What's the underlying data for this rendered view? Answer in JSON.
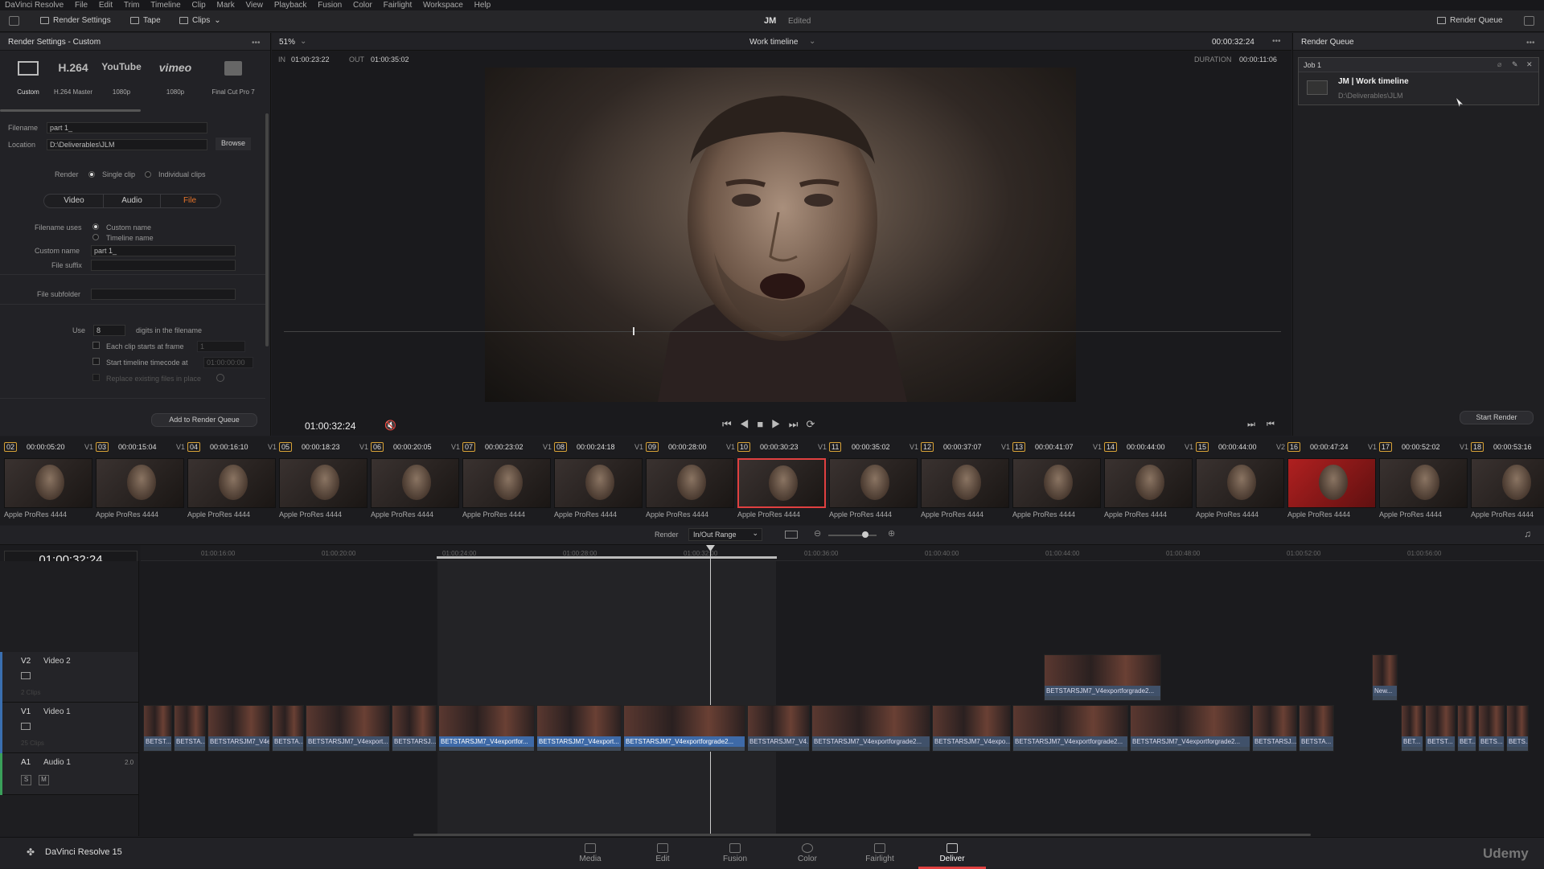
{
  "menu": {
    "app": "DaVinci Resolve",
    "items": [
      "File",
      "Edit",
      "Trim",
      "Timeline",
      "Clip",
      "Mark",
      "View",
      "Playback",
      "Fusion",
      "Color",
      "Fairlight",
      "Workspace",
      "Help"
    ]
  },
  "topbar": {
    "render_settings": "Render Settings",
    "tape": "Tape",
    "clips": "Clips",
    "project": "JM",
    "status": "Edited",
    "render_queue": "Render Queue"
  },
  "left": {
    "title": "Render Settings - Custom",
    "presets": [
      {
        "big": "",
        "label": "Custom"
      },
      {
        "big": "H.264",
        "label": "H.264 Master"
      },
      {
        "big": "YouTube",
        "label": "1080p"
      },
      {
        "big": "vimeo",
        "label": "1080p"
      },
      {
        "big": "",
        "label": "Final Cut Pro 7"
      }
    ],
    "filename_label": "Filename",
    "filename": "part 1_",
    "location_label": "Location",
    "location": "D:\\Deliverables\\JLM",
    "browse": "Browse",
    "render_label": "Render",
    "single_clip": "Single clip",
    "individual_clips": "Individual clips",
    "tabs": [
      "Video",
      "Audio",
      "File"
    ],
    "filename_uses": "Filename uses",
    "custom_name_opt": "Custom name",
    "timeline_name_opt": "Timeline name",
    "custom_name_label": "Custom name",
    "custom_name": "part 1_",
    "file_suffix": "File suffix",
    "file_subfolder": "File subfolder",
    "use": "Use",
    "digits": "8",
    "digits_text": "digits in the filename",
    "each_clip": "Each clip starts at frame",
    "each_clip_val": "1",
    "start_tc": "Start timeline timecode at",
    "start_tc_val": "01:00:00:00",
    "replace": "Replace existing files in place",
    "add_queue": "Add to Render Queue"
  },
  "viewer": {
    "zoom": "51%",
    "timeline": "Work timeline",
    "tc_top": "00:00:32:24",
    "in_label": "IN",
    "in_tc": "01:00:23:22",
    "out_label": "OUT",
    "out_tc": "01:00:35:02",
    "duration_label": "DURATION",
    "duration": "00:00:11:06",
    "current_tc": "01:00:32:24"
  },
  "queue": {
    "title": "Render Queue",
    "job": "Job 1",
    "job_name": "JM | Work timeline",
    "job_path": "D:\\Deliverables\\JLM",
    "start": "Start Render"
  },
  "clips": [
    {
      "n": "02",
      "tc": "00:00:05:20",
      "tr": "V1",
      "codec": "Apple ProRes 4444"
    },
    {
      "n": "03",
      "tc": "00:00:15:04",
      "tr": "V1",
      "codec": "Apple ProRes 4444"
    },
    {
      "n": "04",
      "tc": "00:00:16:10",
      "tr": "V1",
      "codec": "Apple ProRes 4444"
    },
    {
      "n": "05",
      "tc": "00:00:18:23",
      "tr": "V1",
      "codec": "Apple ProRes 4444"
    },
    {
      "n": "06",
      "tc": "00:00:20:05",
      "tr": "V1",
      "codec": "Apple ProRes 4444"
    },
    {
      "n": "07",
      "tc": "00:00:23:02",
      "tr": "V1",
      "codec": "Apple ProRes 4444"
    },
    {
      "n": "08",
      "tc": "00:00:24:18",
      "tr": "V1",
      "codec": "Apple ProRes 4444"
    },
    {
      "n": "09",
      "tc": "00:00:28:00",
      "tr": "V1",
      "codec": "Apple ProRes 4444"
    },
    {
      "n": "10",
      "tc": "00:00:30:23",
      "tr": "V1",
      "codec": "Apple ProRes 4444"
    },
    {
      "n": "11",
      "tc": "00:00:35:02",
      "tr": "V1",
      "codec": "Apple ProRes 4444"
    },
    {
      "n": "12",
      "tc": "00:00:37:07",
      "tr": "V1",
      "codec": "Apple ProRes 4444"
    },
    {
      "n": "13",
      "tc": "00:00:41:07",
      "tr": "V1",
      "codec": "Apple ProRes 4444"
    },
    {
      "n": "14",
      "tc": "00:00:44:00",
      "tr": "V1",
      "codec": "Apple ProRes 4444"
    },
    {
      "n": "15",
      "tc": "00:00:44:00",
      "tr": "V2",
      "codec": "Apple ProRes 4444"
    },
    {
      "n": "16",
      "tc": "00:00:47:24",
      "tr": "V1",
      "codec": "Apple ProRes 4444"
    },
    {
      "n": "17",
      "tc": "00:00:52:02",
      "tr": "V1",
      "codec": "Apple ProRes 4444"
    },
    {
      "n": "18",
      "tc": "00:00:53:16",
      "tr": "",
      "codec": "Apple ProRes 4444"
    }
  ],
  "timeline": {
    "render_label": "Render",
    "render_mode": "In/Out Range",
    "tc": "01:00:32:24",
    "ruler": [
      "01:00:16:00",
      "01:00:20:00",
      "01:00:24:00",
      "01:00:28:00",
      "01:00:32:00",
      "01:00:36:00",
      "01:00:40:00",
      "01:00:44:00",
      "01:00:48:00",
      "01:00:52:00",
      "01:00:56:00"
    ],
    "v2": {
      "id": "V2",
      "name": "Video 2",
      "count": "2 Clips"
    },
    "v1": {
      "id": "V1",
      "name": "Video 1",
      "count": "25 Clips"
    },
    "a1": {
      "id": "A1",
      "name": "Audio 1",
      "ch": "2.0",
      "s": "S",
      "m": "M"
    },
    "v2clips": [
      "BETSTARSJM7_V4exportforgrade2...",
      "New..."
    ],
    "v1clips": [
      "BETST...",
      "BETSTA...",
      "BETSTARSJM7_V4ex...",
      "BETSTA...",
      "BETSTARSJM7_V4export...",
      "BETSTARSJ...",
      "BETSTARSJM7_V4exportfor...",
      "BETSTARSJM7_V4export...",
      "BETSTARSJM7_V4exportforgrade2...",
      "BETSTARSJM7_V4...",
      "BETSTARSJM7_V4exportforgrade2...",
      "BETSTARSJM7_V4expo...",
      "BETSTARSJM7_V4exportforgrade2...",
      "BETSTARSJM7_V4exportforgrade2...",
      "BETSTARSJ...",
      "BETSTA...",
      "BET...",
      "BETST...",
      "BET...",
      "BETS...",
      "BETS..."
    ]
  },
  "pages": [
    "Media",
    "Edit",
    "Fusion",
    "Color",
    "Fairlight",
    "Deliver"
  ],
  "footer": {
    "app": "DaVinci Resolve 15",
    "brand": "Udemy"
  }
}
